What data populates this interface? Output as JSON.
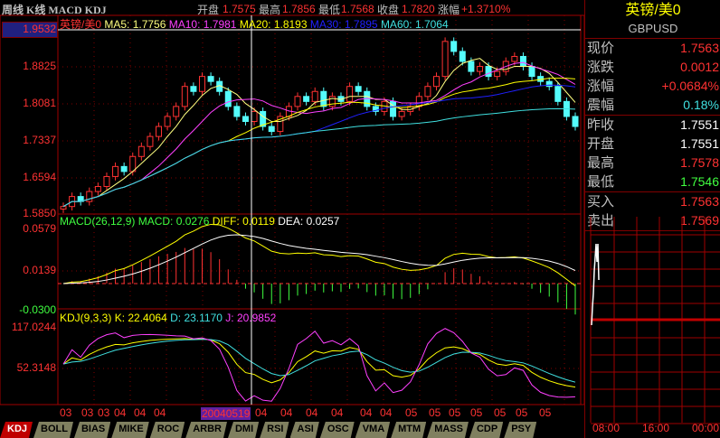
{
  "header": {
    "title": "周线 K线 MACD KDJ",
    "open_label": "开盘",
    "open": "1.7575",
    "high_label": "最高",
    "high": "1.7856",
    "low_label": "最低",
    "low": "1.7568",
    "close_label": "收盘",
    "close": "1.7820",
    "change_label": "涨幅",
    "change": "+1.3710%"
  },
  "main": {
    "name": "英镑/美0",
    "ma5": "MA5: 1.7756",
    "ma10": "MA10: 1.7981",
    "ma20": "MA20: 1.8193",
    "ma30": "MA30: 1.7895",
    "ma60": "MA60: 1.7064",
    "axis": [
      "1.9532",
      "1.8825",
      "1.8081",
      "1.7337",
      "1.6594",
      "1.5850"
    ],
    "ylim": [
      1.585,
      1.9532
    ],
    "closes": [
      1.6,
      1.62,
      1.61,
      1.63,
      1.64,
      1.66,
      1.68,
      1.67,
      1.7,
      1.72,
      1.74,
      1.76,
      1.78,
      1.8,
      1.84,
      1.83,
      1.86,
      1.85,
      1.83,
      1.8,
      1.78,
      1.77,
      1.79,
      1.76,
      1.75,
      1.78,
      1.8,
      1.82,
      1.81,
      1.83,
      1.8,
      1.82,
      1.81,
      1.84,
      1.83,
      1.8,
      1.79,
      1.81,
      1.78,
      1.79,
      1.8,
      1.82,
      1.84,
      1.86,
      1.93,
      1.91,
      1.89,
      1.87,
      1.88,
      1.86,
      1.87,
      1.89,
      1.9,
      1.88,
      1.86,
      1.85,
      1.84,
      1.81,
      1.78,
      1.76
    ]
  },
  "macd": {
    "title": "MACD(26,12,9)",
    "macd": "MACD: 0.0276",
    "diff": "DIFF: 0.0119",
    "dea": "DEA: 0.0257",
    "axis": [
      "0.0579",
      "0.0139",
      "-0.0300"
    ]
  },
  "kdj": {
    "title": "KDJ(9,3,3)",
    "k": "K: 22.4064",
    "d": "D: 23.1170",
    "j": "J: 20.9852",
    "axis": [
      "117.0244",
      "52.3148"
    ]
  },
  "xaxis": {
    "labels": [
      "03",
      "03",
      "03",
      "04",
      "04",
      "04",
      "04",
      "04",
      "04",
      "04",
      "04",
      "04",
      "05",
      "05",
      "05",
      "05",
      "05",
      "05",
      "05"
    ],
    "cursor": "20040519"
  },
  "tabs": [
    "KDJ",
    "BOLL",
    "BIAS",
    "MIKE",
    "ROC",
    "ARBR",
    "DMI",
    "RSI",
    "ASI",
    "OSC",
    "VMA",
    "MTM",
    "MASS",
    "CDP",
    "PSY"
  ],
  "quote": {
    "name": "英镑/美0",
    "code": "GBPUSD",
    "rows": [
      {
        "k": "现价",
        "v": "1.7563",
        "c": "#ff3232"
      },
      {
        "k": "涨跌",
        "v": "0.0012",
        "c": "#ff3232"
      },
      {
        "k": "涨幅",
        "v": "+0.0684%",
        "c": "#ff3232"
      },
      {
        "k": "震幅",
        "v": "0.18%",
        "c": "#40e0e0"
      },
      {
        "k": "昨收",
        "v": "1.7551",
        "c": "#ffffff"
      },
      {
        "k": "开盘",
        "v": "1.7551",
        "c": "#ffffff"
      },
      {
        "k": "最高",
        "v": "1.7578",
        "c": "#ff3232"
      },
      {
        "k": "最低",
        "v": "1.7546",
        "c": "#40ff40"
      },
      {
        "k": "买入",
        "v": "1.7563",
        "c": "#ff3232"
      },
      {
        "k": "卖出",
        "v": "1.7569",
        "c": "#ff3232"
      }
    ]
  },
  "intraday": {
    "times": [
      "08:00",
      "16:00",
      "00:00"
    ]
  },
  "colors": {
    "up": "#ff3232",
    "down": "#54fcfc",
    "ma5": "#ffff80",
    "ma10": "#ff40ff",
    "ma20": "#ffff00",
    "ma30": "#2020ff",
    "ma60": "#40e0e0"
  }
}
